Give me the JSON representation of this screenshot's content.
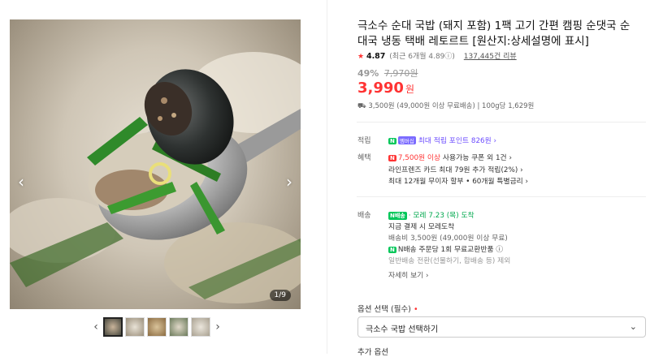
{
  "gallery": {
    "counter": "1/9",
    "prev_arrow": "‹",
    "next_arrow": "›"
  },
  "product": {
    "title": "극소수 순대 국밥 (돼지 포함) 1팩 고기 간편 캠핑 순댓국 순대국 냉동 택배 레토르트 [원산지:상세설명에 표시]",
    "rating": "4.87",
    "rating_sub": "(최근 6개월 4.89ⓘ)",
    "reviews": "137,445건 리뷰",
    "discount": "49%",
    "original_price": "7,970원",
    "price": "3,990",
    "price_unit": "원",
    "shipping_line": "3,500원 (49,000원 이상 무료배송)  |  100g당 1,629원"
  },
  "benefits": {
    "points_label": "적립",
    "points_badge_n": "N",
    "points_badge_m": "멤버십",
    "points_text": "최대 적립 포인트 826원 ›",
    "benefit_label": "혜택",
    "coupon_badge": "N",
    "coupon_amount": "7,500원 이상",
    "coupon_text": " 사용가능 쿠폰 외 1건 ›",
    "card_text": "라인프렌즈 카드 최대 79원 추가 적립(2%) ›",
    "installment_text": "최대 12개월 무이자 할부 • 60개월 특별금리 ›"
  },
  "delivery": {
    "label": "배송",
    "badge": "N배송",
    "eta": "· 모레 7.23 (목) 도착",
    "line1": "지금 결제 시 모레도착",
    "fee": "배송비 3,500원 (49,000원 이상 무료)",
    "n_exchange_badge": "N",
    "n_exchange": "N배송 주문당 1회 무료교환반품 ⓘ",
    "note": "일반배송 전환(선물하기, 합배송 등) 제외",
    "details_link": "자세히 보기 ›"
  },
  "options": {
    "label": "옵션 선택 (필수)",
    "required_mark": "•",
    "select_value": "극소수 국밥 선택하기",
    "more_label": "추가 옵션"
  },
  "colors": {
    "accent_red": "#ff3333",
    "naver_green": "#03c75a",
    "purple": "#6c4cff"
  }
}
